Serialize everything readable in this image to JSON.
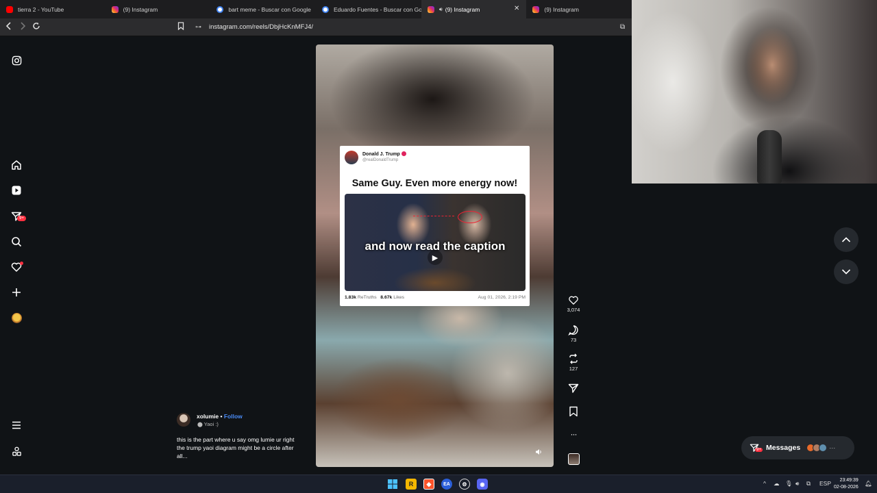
{
  "tabs": [
    {
      "title": "tierra 2 - YouTube",
      "icon": "youtube-icon"
    },
    {
      "title": "(9) Instagram",
      "icon": "instagram-icon"
    },
    {
      "title": "bart meme - Buscar con Google",
      "icon": "google-icon"
    },
    {
      "title": "Eduardo Fuentes - Buscar con Googl",
      "icon": "google-icon"
    },
    {
      "title": "(9) Instagram",
      "icon": "instagram-icon",
      "active": true
    },
    {
      "title": "(9) Instagram",
      "icon": "instagram-icon"
    }
  ],
  "address": {
    "url": "instagram.com/reels/DbjHcKnMFJ4/"
  },
  "sidebar": {
    "items": [
      "instagram-logo",
      "home",
      "reels",
      "messages",
      "search",
      "notifications",
      "create",
      "profile",
      "more",
      "also-from-meta"
    ],
    "messages_badge": "9+"
  },
  "post": {
    "author_name": "Donald J. Trump",
    "author_handle": "@realDonaldTrump",
    "headline": "Same Guy. Even more energy now!",
    "overlay_text": "and now read the caption",
    "retruths_count": "1.83k",
    "retruths_label": "ReTruths",
    "likes_count": "8.67k",
    "likes_label": "Likes",
    "date": "Aug 01, 2026, 2:19 PM"
  },
  "actions": {
    "likes": "3,074",
    "comments": "73",
    "reposts": "127"
  },
  "reel_author": {
    "username": "xolumie",
    "separator": "•",
    "follow_label": "Follow",
    "location": "Yaoi :)",
    "caption": "this is the part where u say omg lumie ur right the trump yaoi diagram might be a circle after all..."
  },
  "messages": {
    "label": "Messages",
    "badge": "9+",
    "more": "···"
  },
  "taskbar": {
    "language": "ESP",
    "time": "23:49:39",
    "date": "02-08-2026"
  },
  "colors": {
    "accent_blue": "#4a8cf7",
    "badge_red": "#ff3040",
    "page_bg": "#101316"
  }
}
